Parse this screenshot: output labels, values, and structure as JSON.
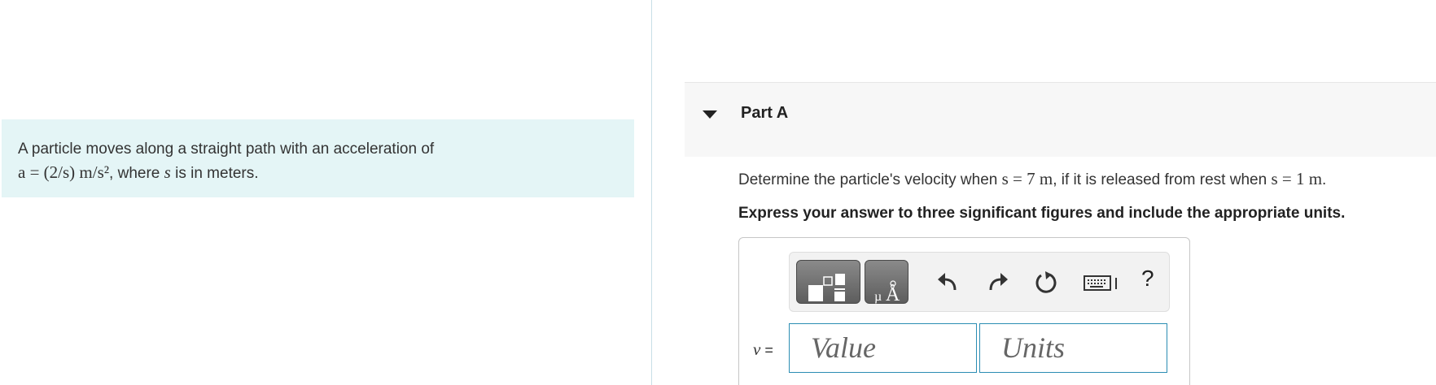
{
  "problem": {
    "intro": "A particle moves along a straight path with an acceleration of",
    "equation": "a = (2/s)  m/s²",
    "suffix_before_var": ", where ",
    "var": "s",
    "suffix_after_var": " is in meters."
  },
  "part": {
    "title": "Part A",
    "question_pre": "Determine the particle's velocity when ",
    "question_cond1": "s = 7 m",
    "question_mid": ", if it is released from rest when ",
    "question_cond2": "s = 1 m",
    "question_end": ".",
    "instruction": "Express your answer to three significant figures and include the appropriate units."
  },
  "answer": {
    "variable_label": "v",
    "equals": " =",
    "value_placeholder": "Value",
    "units_placeholder": "Units",
    "help_label": "?"
  },
  "icons": {
    "templates": "templates-icon",
    "units": "units-icon",
    "undo": "undo-icon",
    "redo": "redo-icon",
    "reset": "reset-icon",
    "keyboard": "keyboard-icon",
    "collapse": "caret-down-icon"
  },
  "colors": {
    "problem_bg": "#e4f5f6",
    "field_border": "#2b8db3",
    "toolbar_button": "#6e6e6e"
  }
}
